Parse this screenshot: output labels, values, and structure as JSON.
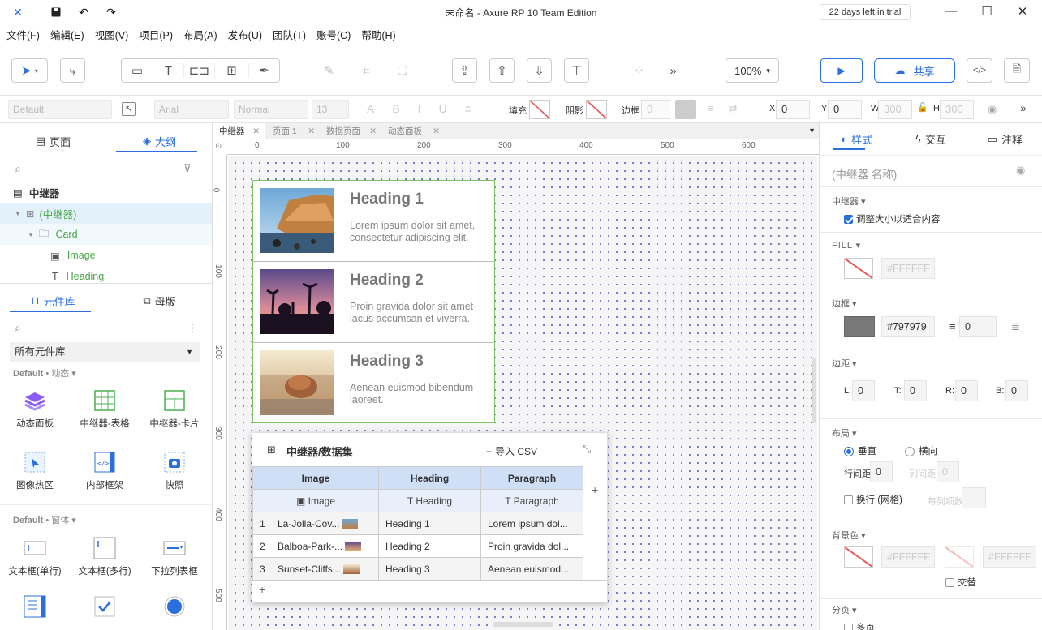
{
  "titlebar": {
    "title": "未命名 - Axure RP 10 Team Edition",
    "trial": "22 days left in trial",
    "min": "—",
    "max": "☐",
    "close": "✕"
  },
  "menu": [
    "文件(F)",
    "编辑(E)",
    "视图(V)",
    "项目(P)",
    "布局(A)",
    "发布(U)",
    "团队(T)",
    "账号(C)",
    "帮助(H)"
  ],
  "toolbar": {
    "zoom": "100%",
    "share": "共享",
    "more": "»"
  },
  "format": {
    "style_sel": "Default",
    "font_sel": "Arial",
    "weight_sel": "Normal",
    "size_sel": "13",
    "fill_label": "填充",
    "shadow_label": "阴影",
    "border_label": "边框",
    "border_val": "0",
    "x_label": "X",
    "x_val": "0",
    "y_label": "Y",
    "y_val": "0",
    "w_label": "W",
    "w_val": "300",
    "h_label": "H",
    "h_val": "300"
  },
  "left": {
    "tabs": {
      "pages": "页面",
      "outline": "大纲"
    },
    "outline": {
      "root": "中继器",
      "items": [
        {
          "label": "(中继器)"
        },
        {
          "label": "Card"
        },
        {
          "label": "Image"
        },
        {
          "label": "Heading"
        }
      ]
    },
    "libtabs": {
      "library": "元件库",
      "masters": "母版"
    },
    "lib_select": "所有元件库",
    "sec1": {
      "name": "Default",
      "sub": "动态"
    },
    "sec2": {
      "name": "Default",
      "sub": "窗体"
    },
    "widgets1": [
      "动态面板",
      "中继器-表格",
      "中继器-卡片",
      "图像热区",
      "内部框架",
      "快照"
    ],
    "widgets2": [
      "文本框(单行)",
      "文本框(多行)",
      "下拉列表框"
    ]
  },
  "canvas": {
    "tabs": [
      "中继器",
      "页面 1",
      "数据页面",
      "动态面板"
    ],
    "hticks": [
      "0",
      "100",
      "200",
      "300",
      "400",
      "500",
      "600"
    ],
    "vticks": [
      "0",
      "100",
      "200",
      "300",
      "400",
      "500"
    ],
    "cards": [
      {
        "heading": "Heading 1",
        "text": "Lorem ipsum dolor sit amet, consectetur adipiscing elit."
      },
      {
        "heading": "Heading 2",
        "text": "Proin gravida dolor sit amet lacus accumsan et viverra."
      },
      {
        "heading": "Heading 3",
        "text": "Aenean euismod bibendum laoreet."
      }
    ]
  },
  "dataset": {
    "title": "中继器/数据集",
    "import": "导入 CSV",
    "add_col": "+",
    "add_row": "+",
    "columns": [
      "Image",
      "Heading",
      "Paragraph"
    ],
    "types": [
      "Image",
      "Heading",
      "Paragraph"
    ],
    "rows": [
      {
        "n": "1",
        "image": "La-Jolla-Cov...",
        "heading": "Heading 1",
        "para": "Lorem ipsum dol..."
      },
      {
        "n": "2",
        "image": "Balboa-Park-...",
        "heading": "Heading 2",
        "para": "Proin gravida dol..."
      },
      {
        "n": "3",
        "image": "Sunset-Cliffs...",
        "heading": "Heading 3",
        "para": "Aenean euismod..."
      }
    ]
  },
  "right": {
    "tabs": {
      "style": "样式",
      "interact": "交互",
      "notes": "注释"
    },
    "name_placeholder": "(中继器 名称)",
    "repeater_lbl": "中继器",
    "fit_content": "调整大小以适合内容",
    "fill_lbl": "FILL",
    "fill_hex": "#FFFFFF",
    "border_lbl": "边框",
    "border_hex": "#797979",
    "border_w": "0",
    "margin_lbl": "边距",
    "L": "L:",
    "T": "T:",
    "R": "R:",
    "B": "B:",
    "l_v": "0",
    "t_v": "0",
    "r_v": "0",
    "b_v": "0",
    "layout_lbl": "布局",
    "vertical": "垂直",
    "horizontal": "横向",
    "row_gap": "行间距",
    "row_gap_v": "0",
    "col_gap": "列间距",
    "col_gap_v": "0",
    "wrap": "换行 (网格)",
    "per_row": "每列项数",
    "bg_lbl": "背景色",
    "bg_hex1": "#FFFFFF",
    "bg_hex2": "#FFFFFF",
    "alternate": "交替",
    "page_lbl": "分页",
    "multi_page": "多页"
  },
  "colors": {
    "accent": "#2a6fdb",
    "outline_green": "#4caf50",
    "border_swatch": "#797979"
  }
}
